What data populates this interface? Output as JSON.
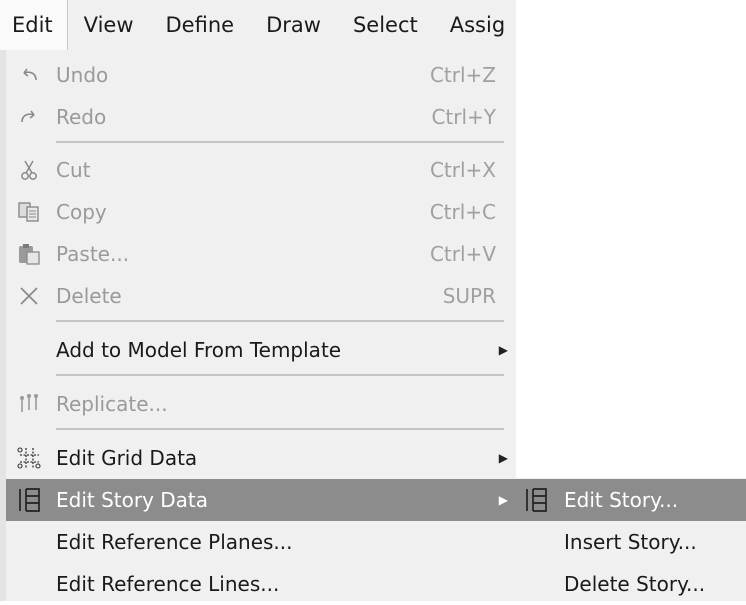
{
  "menubar": {
    "items": [
      "Edit",
      "View",
      "Define",
      "Draw",
      "Select",
      "Assig"
    ]
  },
  "menu": {
    "undo": {
      "label": "Undo",
      "shortcut": "Ctrl+Z"
    },
    "redo": {
      "label": "Redo",
      "shortcut": "Ctrl+Y"
    },
    "cut": {
      "label": "Cut",
      "shortcut": "Ctrl+X"
    },
    "copy": {
      "label": "Copy",
      "shortcut": "Ctrl+C"
    },
    "paste": {
      "label": "Paste...",
      "shortcut": "Ctrl+V"
    },
    "delete": {
      "label": "Delete",
      "shortcut": "SUPR"
    },
    "add_from_template": {
      "label": "Add to Model From Template"
    },
    "replicate": {
      "label": "Replicate..."
    },
    "edit_grid": {
      "label": "Edit Grid Data"
    },
    "edit_story_data": {
      "label": "Edit Story Data"
    },
    "edit_ref_planes": {
      "label": "Edit Reference Planes..."
    },
    "edit_ref_lines": {
      "label": "Edit Reference Lines..."
    }
  },
  "submenu": {
    "edit_story": {
      "label": "Edit Story..."
    },
    "insert_story": {
      "label": "Insert Story..."
    },
    "delete_story": {
      "label": "Delete Story..."
    }
  },
  "icons": {
    "undo": "undo-icon",
    "redo": "redo-icon",
    "cut": "scissors-icon",
    "copy": "copy-icon",
    "paste": "paste-icon",
    "delete": "x-icon",
    "replicate": "replicate-icon",
    "grid": "grid-icon",
    "story": "story-icon"
  },
  "colors": {
    "highlight": "#8c8c8c",
    "menu_bg": "#f0f0f0",
    "disabled_text": "#9a9a9a"
  }
}
